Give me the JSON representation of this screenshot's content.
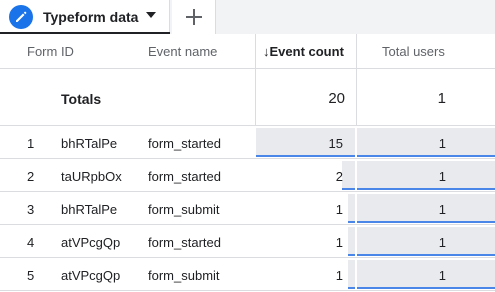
{
  "tab": {
    "title": "Typeform data",
    "icon": "pencil-icon",
    "caret_icon": "caret-down-icon"
  },
  "add_tab": {
    "icon": "plus-icon"
  },
  "table": {
    "headers": {
      "form_id": "Form ID",
      "event_name": "Event name",
      "sort_arrow": "↓",
      "event_count": "Event count",
      "total_users": "Total users"
    },
    "totals": {
      "label": "Totals",
      "event_count": "20",
      "total_users": "1"
    },
    "rows": [
      {
        "index": "1",
        "form_id": "bhRTalPe",
        "event_name": "form_started",
        "event_count": "15",
        "event_count_fraction": 1.0,
        "total_users": "1",
        "total_users_fraction": 1.0
      },
      {
        "index": "2",
        "form_id": "taURpbOx",
        "event_name": "form_started",
        "event_count": "2",
        "event_count_fraction": 0.1333,
        "total_users": "1",
        "total_users_fraction": 1.0
      },
      {
        "index": "3",
        "form_id": "bhRTalPe",
        "event_name": "form_submit",
        "event_count": "1",
        "event_count_fraction": 0.0667,
        "total_users": "1",
        "total_users_fraction": 1.0
      },
      {
        "index": "4",
        "form_id": "atVPcgQp",
        "event_name": "form_started",
        "event_count": "1",
        "event_count_fraction": 0.0667,
        "total_users": "1",
        "total_users_fraction": 1.0
      },
      {
        "index": "5",
        "form_id": "atVPcgQp",
        "event_name": "form_submit",
        "event_count": "1",
        "event_count_fraction": 0.0667,
        "total_users": "1",
        "total_users_fraction": 1.0
      }
    ]
  },
  "colors": {
    "accent": "#1a73e8",
    "bar_line": "#4a86e8",
    "bar_fill": "#e8eaed"
  }
}
